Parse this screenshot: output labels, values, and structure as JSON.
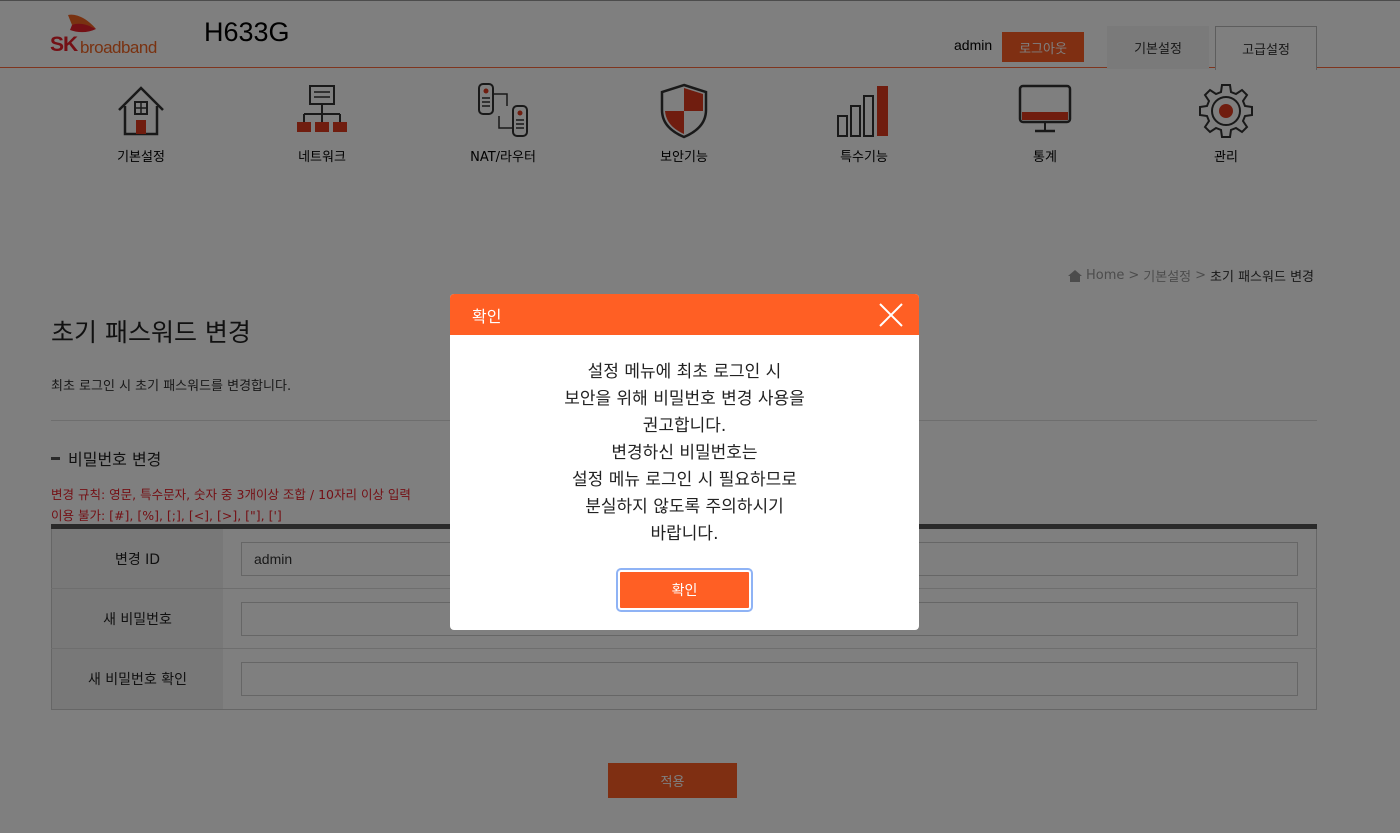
{
  "header": {
    "logo_sk": "SK",
    "logo_broadband": "broadband",
    "model": "H633G",
    "user": "admin",
    "logout_label": "로그아웃",
    "tabs": [
      {
        "label": "기본설정"
      },
      {
        "label": "고급설정"
      }
    ]
  },
  "nav": {
    "items": [
      {
        "label": "기본설정",
        "icon": "house-icon"
      },
      {
        "label": "네트워크",
        "icon": "network-icon"
      },
      {
        "label": "NAT/라우터",
        "icon": "router-icon"
      },
      {
        "label": "보안기능",
        "icon": "shield-icon"
      },
      {
        "label": "특수기능",
        "icon": "bar-chart-icon"
      },
      {
        "label": "통계",
        "icon": "monitor-icon"
      },
      {
        "label": "관리",
        "icon": "gear-icon"
      }
    ]
  },
  "breadcrumb": {
    "home": "Home",
    "sep": ">",
    "level1": "기본설정",
    "current": "초기 패스워드 변경"
  },
  "page": {
    "title": "초기 패스워드 변경",
    "description": "최초 로그인 시 초기 패스워드를 변경합니다.",
    "section_title": "비밀번호 변경",
    "rule_line1": "변경 규칙: 영문, 특수문자, 숫자 중 3개이상 조합 / 10자리 이상 입력",
    "rule_line2": "이용 불가: [#], [%], [;], [<], [>], [\"], [']"
  },
  "form": {
    "rows": [
      {
        "label": "변경 ID",
        "value": "admin"
      },
      {
        "label": "새 비밀번호",
        "value": ""
      },
      {
        "label": "새 비밀번호 확인",
        "value": ""
      }
    ],
    "apply_label": "적용"
  },
  "modal": {
    "title": "확인",
    "lines": [
      "설정 메뉴에 최초 로그인 시",
      "보안을 위해 비밀번호 변경 사용을",
      "권고합니다.",
      "변경하신 비밀번호는",
      "설정 메뉴 로그인 시 필요하므로",
      "분실하지 않도록 주의하시기",
      "바랍니다."
    ],
    "ok_label": "확인"
  },
  "colors": {
    "accent": "#ff5f24",
    "warning_text": "#e8212a"
  }
}
